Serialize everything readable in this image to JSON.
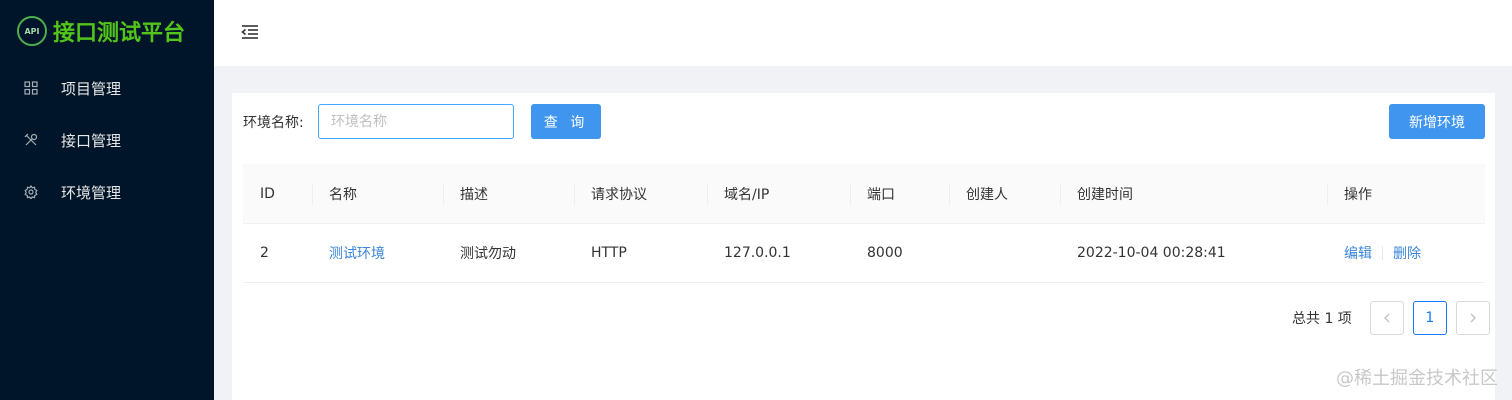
{
  "sidebar": {
    "logo_badge": "API",
    "logo_text": "接口测试平台",
    "items": [
      {
        "label": "项目管理",
        "icon": "grid-icon"
      },
      {
        "label": "接口管理",
        "icon": "tools-icon"
      },
      {
        "label": "环境管理",
        "icon": "gear-icon"
      }
    ]
  },
  "search": {
    "label": "环境名称:",
    "placeholder": "环境名称",
    "query_button": "查 询",
    "add_button": "新增环境"
  },
  "table": {
    "headers": [
      "ID",
      "名称",
      "描述",
      "请求协议",
      "域名/IP",
      "端口",
      "创建人",
      "创建时间",
      "操作"
    ],
    "rows": [
      {
        "id": "2",
        "name": "测试环境",
        "desc": "测试勿动",
        "protocol": "HTTP",
        "host": "127.0.0.1",
        "port": "8000",
        "creator": "",
        "created_at": "2022-10-04 00:28:41",
        "edit": "编辑",
        "delete": "删除"
      }
    ]
  },
  "pagination": {
    "total": "总共 1 项",
    "current": "1"
  },
  "watermark": "@稀土掘金技术社区",
  "colors": {
    "sidebar_bg": "#001529",
    "primary": "#4096ee",
    "logo_green": "#52c41a"
  }
}
